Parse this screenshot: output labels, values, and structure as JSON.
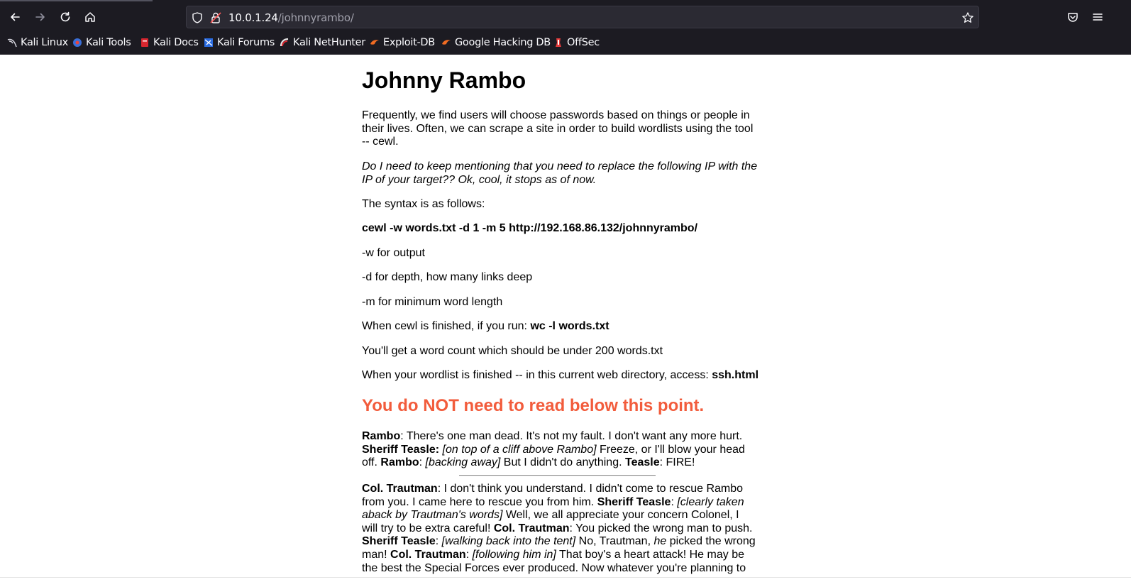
{
  "browser": {
    "url_host": "10.0.1.24",
    "url_path": "/johnnyrambo/",
    "bookmarks": [
      "Kali Linux",
      "Kali Tools",
      "Kali Docs",
      "Kali Forums",
      "Kali NetHunter",
      "Exploit-DB",
      "Google Hacking DB",
      "OffSec"
    ]
  },
  "page": {
    "title": "Johnny Rambo",
    "intro": "Frequently, we find users will choose passwords based on things or people in their lives. Often, we can scrape a site in order to build wordlists using the tool -- cewl.",
    "note": "Do I need to keep mentioning that you need to replace the following IP with the IP of your target?? Ok, cool, it stops as of now.",
    "syntax_label": "The syntax is as follows:",
    "command": "cewl -w words.txt -d 1 -m 5 http://192.168.86.132/johnnyrambo/",
    "opt_w": "-w for output",
    "opt_d": "-d for depth, how many links deep",
    "opt_m": "-m for minimum word length",
    "wc_prefix": "When cewl is finished, if you run: ",
    "wc_cmd": "wc -l words.txt",
    "wordcount": "You'll get a word count which should be under 200 words.txt",
    "access_prefix": "When your wordlist is finished -- in this current web directory, access: ",
    "access_file": "ssh.html",
    "warning": "You do NOT need to read below this point.",
    "quote1": [
      {
        "t": "Rambo",
        "s": "b"
      },
      {
        "t": ": There's one man dead. It's not my fault. I don't want any more hurt. ",
        "s": ""
      },
      {
        "t": "Sheriff Teasle:",
        "s": "b"
      },
      {
        "t": " ",
        "s": ""
      },
      {
        "t": "[on top of a cliff above Rambo]",
        "s": "i"
      },
      {
        "t": " Freeze, or I'll blow your head off. ",
        "s": ""
      },
      {
        "t": "Rambo",
        "s": "b"
      },
      {
        "t": ": ",
        "s": ""
      },
      {
        "t": "[backing away]",
        "s": "i"
      },
      {
        "t": " But I didn't do anything. ",
        "s": ""
      },
      {
        "t": "Teasle",
        "s": "b"
      },
      {
        "t": ": FIRE!",
        "s": ""
      }
    ],
    "quote2": [
      {
        "t": "Col. Trautman",
        "s": "b"
      },
      {
        "t": ": I don't think you understand. I didn't come to rescue Rambo from you. I came here to rescue you from him. ",
        "s": ""
      },
      {
        "t": "Sheriff Teasle",
        "s": "b"
      },
      {
        "t": ": ",
        "s": ""
      },
      {
        "t": "[clearly taken aback by Trautman's words]",
        "s": "i"
      },
      {
        "t": " Well, we all appreciate your concern Colonel, I will try to be extra careful! ",
        "s": ""
      },
      {
        "t": "Col. Trautman",
        "s": "b"
      },
      {
        "t": ": You picked the wrong man to push. ",
        "s": ""
      },
      {
        "t": "Sheriff Teasle",
        "s": "b"
      },
      {
        "t": ": ",
        "s": ""
      },
      {
        "t": "[walking back into the tent]",
        "s": "i"
      },
      {
        "t": " No, Trautman, ",
        "s": ""
      },
      {
        "t": "he",
        "s": "i"
      },
      {
        "t": " picked the wrong man! ",
        "s": ""
      },
      {
        "t": "Col. Trautman",
        "s": "b"
      },
      {
        "t": ": ",
        "s": ""
      },
      {
        "t": "[following him in]",
        "s": "i"
      },
      {
        "t": " That boy's a heart attack! He may be the best the Special Forces ever produced. Now whatever you're planning to",
        "s": ""
      }
    ]
  }
}
